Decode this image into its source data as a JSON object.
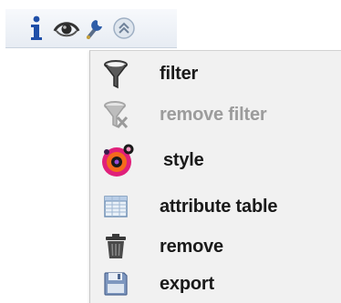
{
  "toolbar": {
    "icons": [
      {
        "name": "info-icon"
      },
      {
        "name": "visibility-eye-icon"
      },
      {
        "name": "settings-wrench-icon"
      },
      {
        "name": "collapse-chevron-icon"
      }
    ]
  },
  "menu": {
    "items": [
      {
        "label": "filter",
        "icon": "filter-funnel-icon",
        "enabled": true
      },
      {
        "label": "remove filter",
        "icon": "remove-filter-icon",
        "enabled": false
      },
      {
        "label": "style",
        "icon": "style-palette-icon",
        "enabled": true
      },
      {
        "label": "attribute table",
        "icon": "attribute-table-icon",
        "enabled": true
      },
      {
        "label": "remove",
        "icon": "trash-icon",
        "enabled": true
      },
      {
        "label": "export",
        "icon": "export-floppy-icon",
        "enabled": true
      }
    ]
  },
  "colors": {
    "menu_background": "#f1f1f1",
    "text": "#1a1a1a",
    "text_disabled": "#9c9c9c",
    "info_blue": "#1f4fa8",
    "style_pink": "#e0207a"
  }
}
